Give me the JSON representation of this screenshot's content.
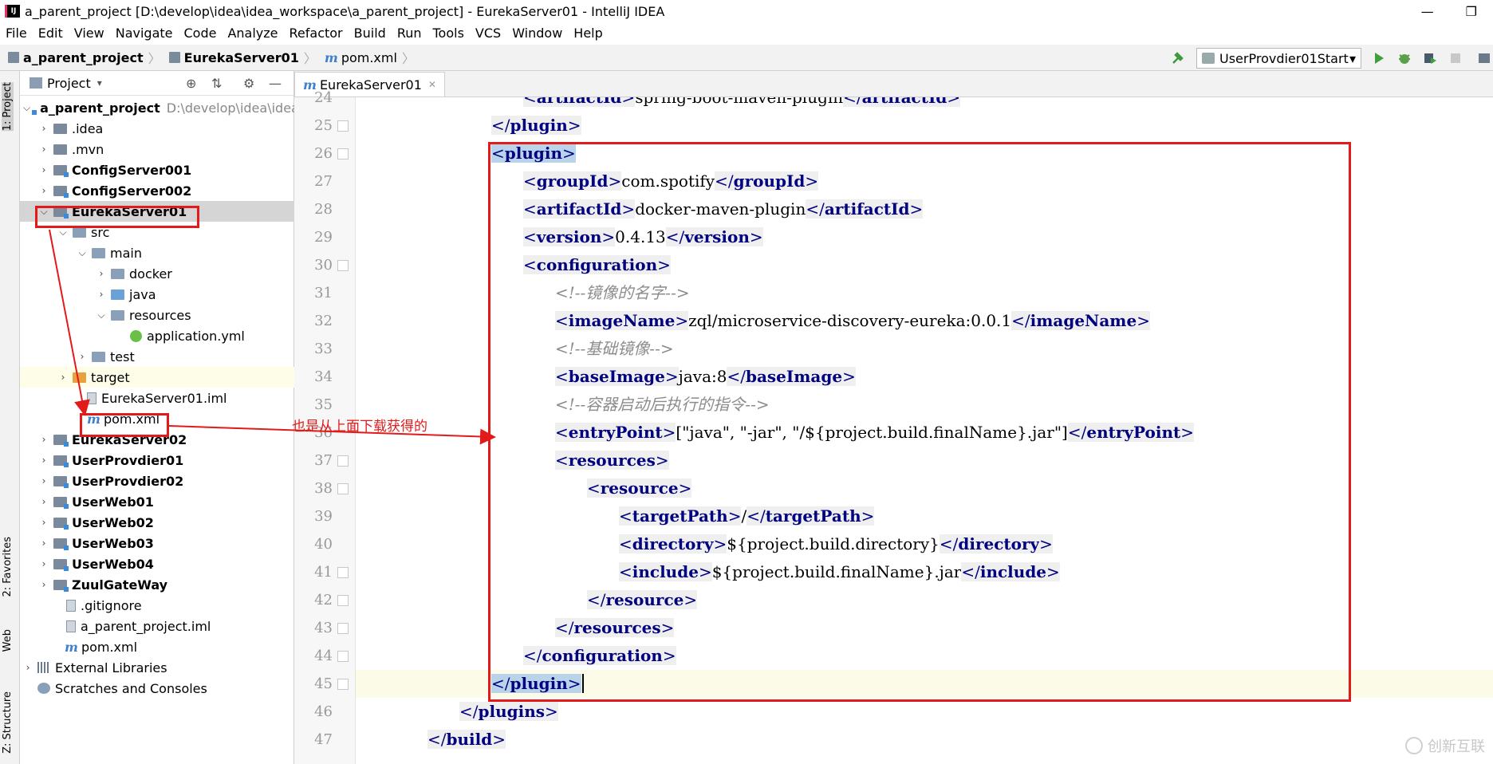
{
  "window": {
    "title": "a_parent_project [D:\\develop\\idea\\idea_workspace\\a_parent_project] - EurekaServer01 - IntelliJ IDEA",
    "app_icon": "IJ",
    "controls": [
      "—",
      "❐"
    ]
  },
  "menu": [
    "File",
    "Edit",
    "View",
    "Navigate",
    "Code",
    "Analyze",
    "Refactor",
    "Build",
    "Run",
    "Tools",
    "VCS",
    "Window",
    "Help"
  ],
  "breadcrumb": [
    "a_parent_project",
    "EurekaServer01",
    "pom.xml"
  ],
  "run_config": {
    "label": "UserProvdier01Start",
    "dropdown": "▾"
  },
  "side_tabs": [
    "1: Project",
    "2: Favorites",
    "Web",
    "Z: Structure"
  ],
  "project_panel": {
    "title": "Project",
    "dropdown": "▾",
    "tree": [
      {
        "label": "a_parent_project",
        "path": "D:\\develop\\idea\\idea"
      },
      {
        "label": ".idea"
      },
      {
        "label": ".mvn"
      },
      {
        "label": "ConfigServer001"
      },
      {
        "label": "ConfigServer002"
      },
      {
        "label": "EurekaServer01"
      },
      {
        "label": "src"
      },
      {
        "label": "main"
      },
      {
        "label": "docker"
      },
      {
        "label": "java"
      },
      {
        "label": "resources"
      },
      {
        "label": "application.yml"
      },
      {
        "label": "test"
      },
      {
        "label": "target"
      },
      {
        "label": "EurekaServer01.iml"
      },
      {
        "label": "pom.xml"
      },
      {
        "label": "EurekaServer02"
      },
      {
        "label": "UserProvdier01"
      },
      {
        "label": "UserProvdier02"
      },
      {
        "label": "UserWeb01"
      },
      {
        "label": "UserWeb02"
      },
      {
        "label": "UserWeb03"
      },
      {
        "label": "UserWeb04"
      },
      {
        "label": "ZuulGateWay"
      },
      {
        "label": ".gitignore"
      },
      {
        "label": "a_parent_project.iml"
      },
      {
        "label": "pom.xml"
      },
      {
        "label": "External Libraries"
      },
      {
        "label": "Scratches and Consoles"
      }
    ]
  },
  "editor": {
    "tab": "EurekaServer01",
    "lines": [
      {
        "num": "24",
        "parts": [
          "<",
          "artifactId",
          ">",
          "spring-boot-maven-plugin",
          "</",
          "artifactId",
          ">"
        ]
      },
      {
        "num": "25",
        "parts": [
          "</",
          "plugin",
          ">"
        ]
      },
      {
        "num": "26",
        "parts": [
          "<",
          "plugin",
          ">"
        ]
      },
      {
        "num": "27",
        "parts": [
          "<",
          "groupId",
          ">",
          "com.spotify",
          "</",
          "groupId",
          ">"
        ]
      },
      {
        "num": "28",
        "parts": [
          "<",
          "artifactId",
          ">",
          "docker-maven-plugin",
          "</",
          "artifactId",
          ">"
        ]
      },
      {
        "num": "29",
        "parts": [
          "<",
          "version",
          ">",
          "0.4.13",
          "</",
          "version",
          ">"
        ]
      },
      {
        "num": "30",
        "parts": [
          "<",
          "configuration",
          ">"
        ]
      },
      {
        "num": "31",
        "comment": "<!--镜像的名字-->"
      },
      {
        "num": "32",
        "parts": [
          "<",
          "imageName",
          ">",
          "zql/microservice-discovery-eureka:0.0.1",
          "</",
          "imageName",
          ">"
        ]
      },
      {
        "num": "33",
        "comment": "<!--基础镜像-->"
      },
      {
        "num": "34",
        "parts": [
          "<",
          "baseImage",
          ">",
          "java:8",
          "</",
          "baseImage",
          ">"
        ]
      },
      {
        "num": "35",
        "comment": "<!--容器启动后执行的指令-->"
      },
      {
        "num": "36",
        "parts": [
          "<",
          "entryPoint",
          ">",
          "[\"java\", \"-jar\", \"/${project.build.finalName}.jar\"]",
          "</",
          "entryPoint",
          ">"
        ]
      },
      {
        "num": "37",
        "parts": [
          "<",
          "resources",
          ">"
        ]
      },
      {
        "num": "38",
        "parts": [
          "<",
          "resource",
          ">"
        ]
      },
      {
        "num": "39",
        "parts": [
          "<",
          "targetPath",
          ">",
          "/",
          "</",
          "targetPath",
          ">"
        ]
      },
      {
        "num": "40",
        "parts": [
          "<",
          "directory",
          ">",
          "${project.build.directory}",
          "</",
          "directory",
          ">"
        ]
      },
      {
        "num": "41",
        "parts": [
          "<",
          "include",
          ">",
          "${project.build.finalName}.jar",
          "</",
          "include",
          ">"
        ]
      },
      {
        "num": "42",
        "parts": [
          "</",
          "resource",
          ">"
        ]
      },
      {
        "num": "43",
        "parts": [
          "</",
          "resources",
          ">"
        ]
      },
      {
        "num": "44",
        "parts": [
          "</",
          "configuration",
          ">"
        ]
      },
      {
        "num": "45",
        "parts": [
          "</",
          "plugin",
          ">"
        ]
      },
      {
        "num": "46",
        "parts": [
          "</",
          "plugins",
          ">"
        ]
      },
      {
        "num": "47",
        "parts": [
          "</",
          "build",
          ">"
        ]
      }
    ]
  },
  "annotation": {
    "text": "也是从上面下载获得的",
    "color": "#e21a1a"
  },
  "watermark": "创新互联",
  "colors": {
    "tag": "#000080",
    "comment": "#8c8c8c",
    "annotation": "#e21a1a",
    "selection": "#b9d4ea",
    "module_folder": "#3c8ad8"
  }
}
